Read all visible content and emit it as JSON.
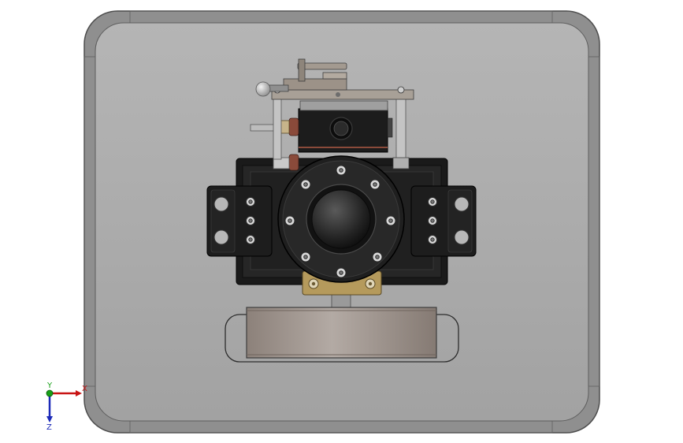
{
  "viewport": {
    "background": "#ffffff"
  },
  "model": {
    "plate_color": "#a9a9a9",
    "plate_edge_color": "#6e6e6e",
    "body_color": "#1e1e1e",
    "flange_color": "#2a2a2a",
    "bolt_color": "#d9d9d9",
    "brass_color": "#b59a5c",
    "copper_color": "#8a4a3a",
    "drum_color": "#9b8f88",
    "handle_knob_color": "#cfcfcf"
  },
  "triad": {
    "x_label": "X",
    "y_label": "Y",
    "z_label": "Z",
    "x_color": "#c81414",
    "y_color": "#17a017",
    "z_color": "#1c2ab8"
  }
}
